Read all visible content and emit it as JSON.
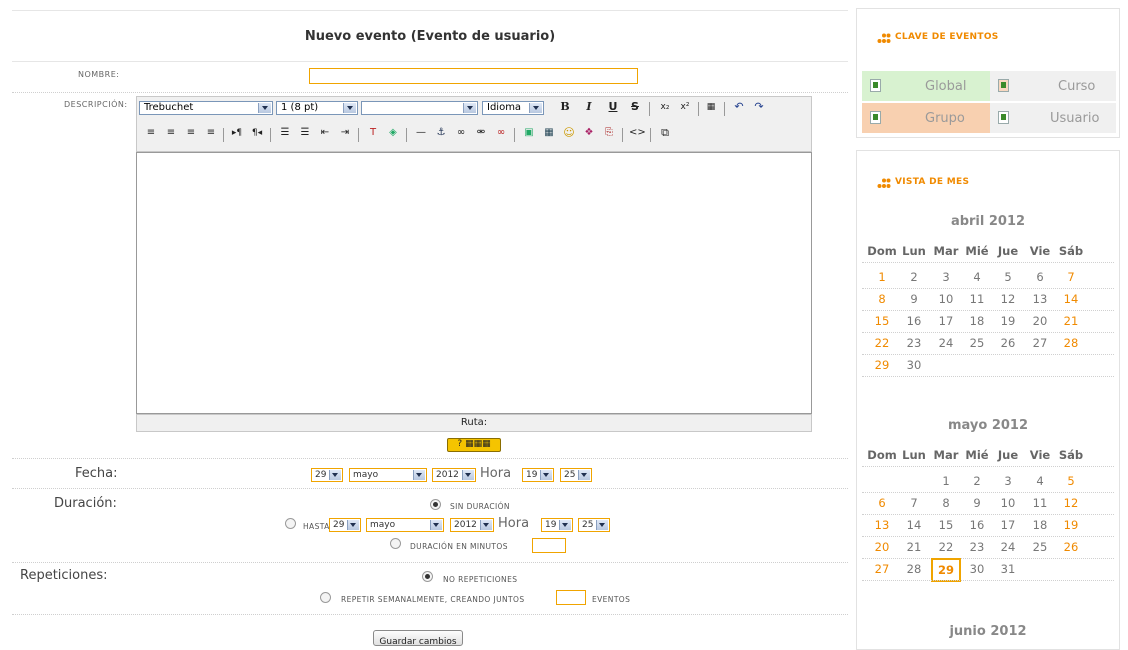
{
  "form": {
    "title": "Nuevo evento (Evento de usuario)",
    "name_label": "NOMBRE:",
    "name_value": "",
    "description_label": "DESCRIPCIÓN:",
    "editor": {
      "font_family": "Trebuchet",
      "font_size": "1 (8 pt)",
      "style_value": "",
      "language": "Idioma",
      "path_label": "Ruta:",
      "help_label": "?"
    },
    "date_label": "Fecha:",
    "date": {
      "day": "29",
      "month": "mayo",
      "year": "2012",
      "hora_label": "Hora",
      "hour": "19",
      "minute": "25"
    },
    "duration_label": "Duración:",
    "duration_options": {
      "none": "SIN DURACIÓN",
      "until": "HASTA",
      "minutes": "DURACIÓN EN MINUTOS"
    },
    "until": {
      "day": "29",
      "month": "mayo",
      "year": "2012",
      "hora_label": "Hora",
      "hour": "19",
      "minute": "25"
    },
    "repeat_label": "Repeticiones:",
    "repeat_options": {
      "none": "NO REPETICIONES",
      "weekly": "REPETIR SEMANALMENTE, CREANDO JUNTOS",
      "events": "EVENTOS"
    },
    "save_button": "Guardar cambios"
  },
  "sidebar": {
    "events_key": {
      "title": "CLAVE DE EVENTOS",
      "items": [
        "Global",
        "Curso",
        "Grupo",
        "Usuario"
      ],
      "colors": {
        "global": "#d8f2d0",
        "curso": "#f8d8c0",
        "grupo": "#f8d0b0",
        "usuario": "#f0f0f0"
      }
    },
    "month_view": {
      "title": "VISTA DE MES",
      "weekdays": [
        "Dom",
        "Lun",
        "Mar",
        "Mié",
        "Jue",
        "Vie",
        "Sáb"
      ],
      "months": [
        {
          "title": "abril 2012",
          "weeks": [
            [
              "1",
              "2",
              "3",
              "4",
              "5",
              "6",
              "7"
            ],
            [
              "8",
              "9",
              "10",
              "11",
              "12",
              "13",
              "14"
            ],
            [
              "15",
              "16",
              "17",
              "18",
              "19",
              "20",
              "21"
            ],
            [
              "22",
              "23",
              "24",
              "25",
              "26",
              "27",
              "28"
            ],
            [
              "29",
              "30",
              "",
              "",
              "",
              "",
              ""
            ]
          ]
        },
        {
          "title": "mayo 2012",
          "weeks": [
            [
              "",
              "",
              "1",
              "2",
              "3",
              "4",
              "5"
            ],
            [
              "6",
              "7",
              "8",
              "9",
              "10",
              "11",
              "12"
            ],
            [
              "13",
              "14",
              "15",
              "16",
              "17",
              "18",
              "19"
            ],
            [
              "20",
              "21",
              "22",
              "23",
              "24",
              "25",
              "26"
            ],
            [
              "27",
              "28",
              "29",
              "30",
              "31",
              "",
              ""
            ]
          ],
          "today": "29"
        },
        {
          "title": "junio 2012"
        }
      ]
    },
    "accent_color": "#f08a00"
  }
}
